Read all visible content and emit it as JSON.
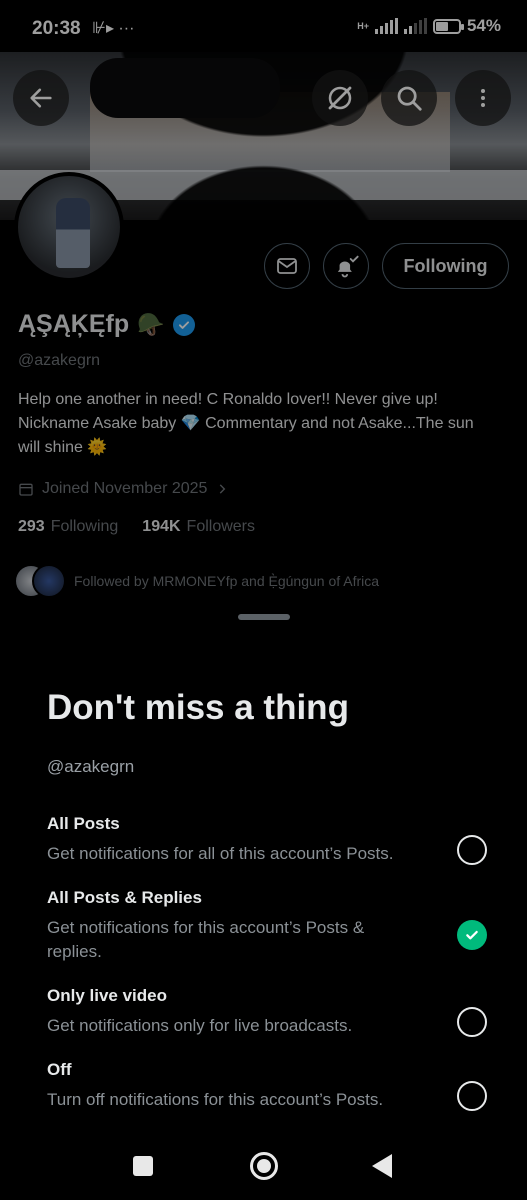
{
  "status_bar": {
    "time": "20:38",
    "left_icons": "⊮▸ ···",
    "network_type": "H+",
    "battery": "54%",
    "battery_level": 0.54
  },
  "header": {
    "back_icon": "arrow-left-icon",
    "grok_icon": "grok-icon",
    "search_icon": "search-icon",
    "more_icon": "more-vertical-icon"
  },
  "profile": {
    "display_name": "ĄŞĄĶĘfp",
    "name_emoji": "🪖",
    "handle": "@azakegrn",
    "bio": "Help one another in need! C Ronaldo lover!! Never give up! Nickname Asake baby 💎 Commentary and not Asake...The sun will shine 🌞",
    "joined": "Joined November 2025",
    "following_count": "293",
    "following_label": "Following",
    "followers_count": "194K",
    "followers_label": "Followers",
    "followed_by": "Followed by MRMONEYfp and Ẹ̀gúngun of Africa",
    "follow_button": "Following"
  },
  "sheet": {
    "title": "Don't miss a thing",
    "handle": "@azakegrn",
    "options": [
      {
        "title": "All Posts",
        "desc": "Get notifications for all of this account’s Posts.",
        "selected": false
      },
      {
        "title": "All Posts & Replies",
        "desc": "Get notifications for this account’s Posts & replies.",
        "selected": true
      },
      {
        "title": "Only live video",
        "desc": "Get notifications only for live broadcasts.",
        "selected": false
      },
      {
        "title": "Off",
        "desc": "Turn off notifications for this account’s Posts.",
        "selected": false
      }
    ]
  },
  "colors": {
    "accent_green": "#00ba7c",
    "verified_blue": "#1d9bf0",
    "background": "#000000"
  }
}
